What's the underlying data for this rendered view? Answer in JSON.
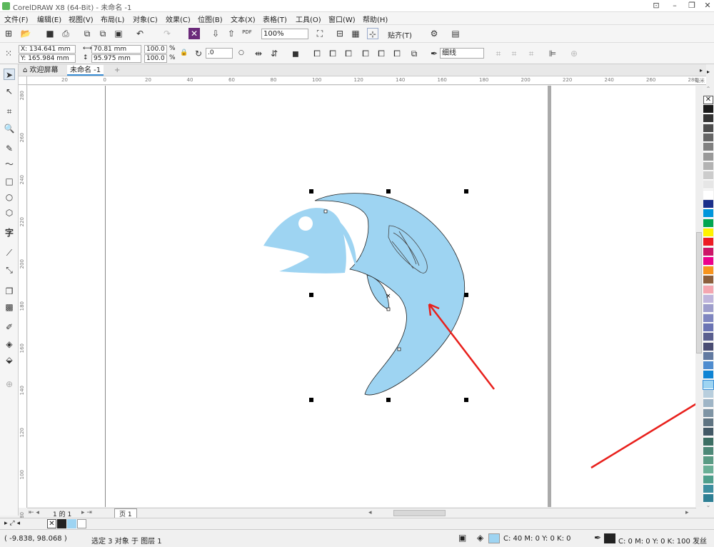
{
  "app": {
    "title": "CorelDRAW X8 (64-Bit) - 未命名 -1"
  },
  "menu": [
    "文件(F)",
    "编辑(E)",
    "视图(V)",
    "布局(L)",
    "对象(C)",
    "效果(C)",
    "位图(B)",
    "文本(X)",
    "表格(T)",
    "工具(O)",
    "窗口(W)",
    "帮助(H)"
  ],
  "toolbar": {
    "zoom": "100%",
    "pdf_label": "PDF",
    "snap_label": "贴齐(T)"
  },
  "property_bar": {
    "x": "X: 134.641 mm",
    "y": "Y: 165.984 mm",
    "width": "70.81 mm",
    "height": "95.975 mm",
    "scale_x": "100.0",
    "scale_y": "100.0",
    "pct": "%",
    "angle": ".0",
    "outline_width": "细线"
  },
  "tabs": {
    "welcome": "欢迎屏幕",
    "doc": "未命名 -1"
  },
  "rulers": {
    "h": [
      "20",
      "0",
      "20",
      "40",
      "60",
      "80",
      "100",
      "120",
      "140",
      "160",
      "180",
      "200",
      "220",
      "240",
      "260",
      "280"
    ],
    "v": [
      "280",
      "260",
      "240",
      "220",
      "200",
      "180",
      "160",
      "140",
      "120",
      "100",
      "80"
    ],
    "unit": "毫米"
  },
  "page_nav": {
    "counter": "1 的 1",
    "page_tab": "页 1"
  },
  "status": {
    "coords": "( -9.838, 98.068 )",
    "selection": "选定 3 对象 于 图层 1",
    "fill": "C: 40 M: 0 Y: 0 K: 0",
    "outline": "C: 0 M: 0 Y: 0 K: 100  发丝"
  },
  "colors": {
    "fish": "#9ed4f2",
    "annotation": "#e8201c"
  },
  "palette": [
    "#1a1a1a",
    "#333333",
    "#4d4d4d",
    "#666666",
    "#808080",
    "#999999",
    "#b3b3b3",
    "#cccccc",
    "#e6e6e6",
    "#ffffff",
    "#1b2f8a",
    "#0096dc",
    "#00a651",
    "#fff200",
    "#ed1c24",
    "#cc1668",
    "#ec008c",
    "#f7941d",
    "#8b5e3c",
    "#f4a6b0",
    "#bfb5dc",
    "#9e9ecc",
    "#7f86c0",
    "#6b74b4",
    "#5a5f8f",
    "#4a4d73",
    "#627aa1",
    "#4f8ccf",
    "#0e84d4",
    "#9ed4f2",
    "#b8cedd",
    "#9fb5c6",
    "#7e94a4",
    "#5f7482",
    "#435966",
    "#3c6e63",
    "#4d8877",
    "#5a9b84",
    "#6aaf96",
    "#4f9f8c",
    "#3e8fa0",
    "#2e7f94"
  ],
  "icons": [
    "pointer-icon",
    "shape-icon",
    "crop-icon",
    "zoom-icon",
    "freehand-icon",
    "artistic-media-icon",
    "rectangle-icon",
    "ellipse-icon",
    "polygon-icon",
    "text-icon",
    "line-icon",
    "connector-icon",
    "shadow-icon",
    "transparency-icon",
    "eyedropper-icon",
    "fill-icon",
    "smart-fill-icon",
    "add-icon"
  ]
}
